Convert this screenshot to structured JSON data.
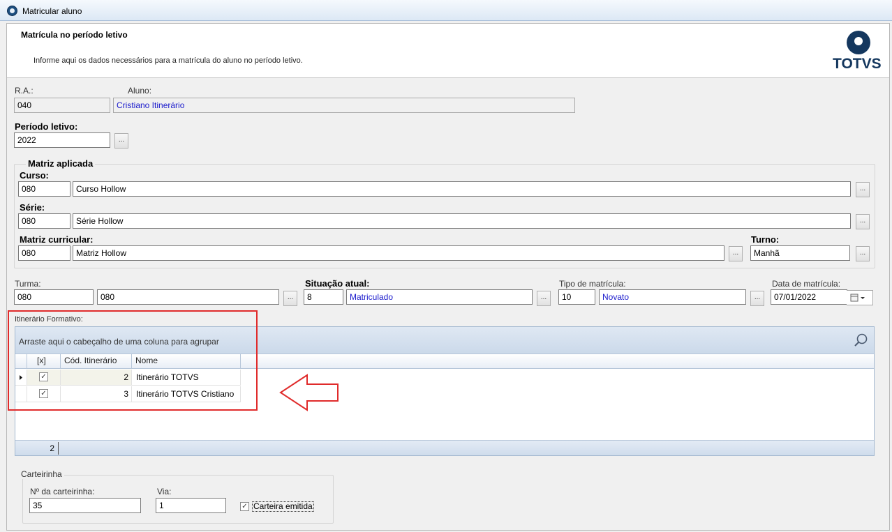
{
  "window": {
    "title": "Matricular aluno"
  },
  "header": {
    "title": "Matrícula no período letivo",
    "subtitle": "Informe aqui os dados necessários para a matrícula do aluno no período letivo.",
    "logo_text": "TOTVS"
  },
  "ra": {
    "label": "R.A.:",
    "value": "040"
  },
  "aluno": {
    "label": "Aluno:",
    "value": "Cristiano Itinerário"
  },
  "periodo": {
    "label": "Período letivo:",
    "value": "2022"
  },
  "lookup_label": "...",
  "matriz_aplicada": {
    "title": "Matriz aplicada",
    "curso": {
      "label": "Curso:",
      "code": "080",
      "name": "Curso Hollow"
    },
    "serie": {
      "label": "Série:",
      "code": "080",
      "name": "Série Hollow"
    },
    "matriz": {
      "label": "Matriz curricular:",
      "code": "080",
      "name": "Matriz Hollow"
    },
    "turno": {
      "label": "Turno:",
      "value": "Manhã"
    }
  },
  "turma": {
    "label": "Turma:",
    "code": "080",
    "name": "080"
  },
  "situacao": {
    "label": "Situação atual:",
    "code": "8",
    "name": "Matriculado"
  },
  "tipo": {
    "label": "Tipo de matrícula:",
    "code": "10",
    "name": "Novato"
  },
  "data_matricula": {
    "label": "Data de matrícula:",
    "value": "07/01/2022"
  },
  "itinerario": {
    "label": "Itinerário Formativo:",
    "group_hint": "Arraste aqui o cabeçalho de uma coluna para agrupar",
    "columns": [
      "[x]",
      "Cód. Itinerário",
      "Nome"
    ],
    "rows": [
      {
        "checked": true,
        "code": "2",
        "name": "Itinerário TOTVS"
      },
      {
        "checked": true,
        "code": "3",
        "name": "Itinerário TOTVS Cristiano"
      }
    ],
    "footer_count": "2"
  },
  "carteirinha": {
    "title": "Carteirinha",
    "numero_label": "Nº da carteirinha:",
    "numero_value": "35",
    "via_label": "Via:",
    "via_value": "1",
    "emitida_label": "Carteira emitida",
    "emitida_checked": true
  },
  "colors": {
    "annotation_red": "#e02b2b",
    "brand": "#14375e",
    "link_blue": "#1a1acc"
  }
}
